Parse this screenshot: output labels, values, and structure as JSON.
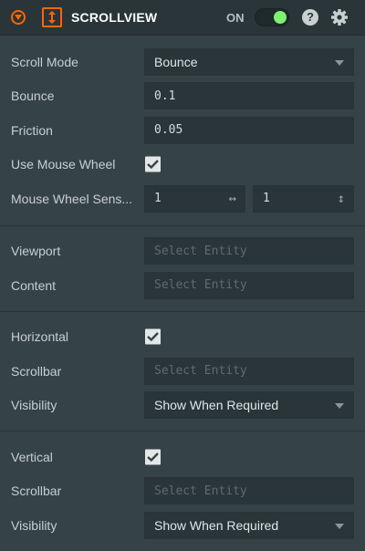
{
  "header": {
    "title": "SCROLLVIEW",
    "on_label": "ON",
    "enabled": true,
    "help_glyph": "?",
    "icons": [
      "chevron-down-icon",
      "scrollview-icon",
      "help-icon",
      "gear-icon"
    ],
    "accent_color": "#ff6600",
    "toggle_color": "#7cf26e"
  },
  "general": {
    "scroll_mode_label": "Scroll Mode",
    "scroll_mode_value": "Bounce",
    "bounce_label": "Bounce",
    "bounce_value": "0.1",
    "friction_label": "Friction",
    "friction_value": "0.05",
    "use_mouse_wheel_label": "Use Mouse Wheel",
    "use_mouse_wheel_checked": true,
    "mouse_wheel_sensitivity_label": "Mouse Wheel Sens...",
    "mouse_wheel_sensitivity_x": "1",
    "mouse_wheel_sensitivity_y": "1"
  },
  "entities": {
    "viewport_label": "Viewport",
    "content_label": "Content",
    "placeholder": "Select Entity"
  },
  "horizontal": {
    "label": "Horizontal",
    "checked": true,
    "scrollbar_label": "Scrollbar",
    "visibility_label": "Visibility",
    "visibility_value": "Show When Required"
  },
  "vertical": {
    "label": "Vertical",
    "checked": true,
    "scrollbar_label": "Scrollbar",
    "visibility_label": "Visibility",
    "visibility_value": "Show When Required"
  }
}
